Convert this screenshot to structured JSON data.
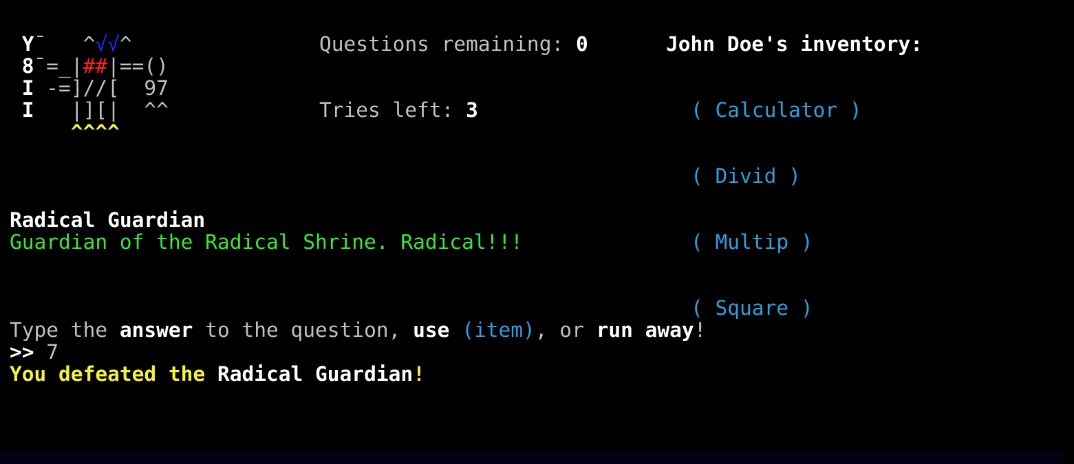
{
  "hud": {
    "questions_label": "Questions remaining: ",
    "questions_value": "0",
    "tries_label": "Tries left: ",
    "tries_value": "3"
  },
  "inventory": {
    "title": "John Doe's inventory:",
    "items": [
      "( Calculator )",
      "( Divid )",
      "( Multip )",
      "( Square )"
    ]
  },
  "art": {
    "line1": [
      {
        "t": " Y",
        "c": "white",
        "b": true
      },
      {
        "t": "¯   ",
        "c": "gray"
      },
      {
        "t": "^",
        "c": "gray"
      },
      {
        "t": "√√",
        "c": "blue"
      },
      {
        "t": "^",
        "c": "gray"
      }
    ],
    "line2": [
      {
        "t": " 8",
        "c": "white",
        "b": true
      },
      {
        "t": "¯=_|",
        "c": "gray"
      },
      {
        "t": "##",
        "c": "red"
      },
      {
        "t": "|==()",
        "c": "gray"
      }
    ],
    "line3": [
      {
        "t": " I",
        "c": "white",
        "b": true
      },
      {
        "t": " -=]//[  97",
        "c": "gray"
      }
    ],
    "line4": [
      {
        "t": " I",
        "c": "white",
        "b": true
      },
      {
        "t": "   |][|  ^^",
        "c": "gray"
      }
    ],
    "line5": [
      {
        "t": "     ^^^^",
        "c": "yellow",
        "b": true
      }
    ]
  },
  "enemy": {
    "name": "Radical Guardian",
    "description": "Guardian of the Radical Shrine. Radical!!!"
  },
  "prompt": {
    "p1": "Type the ",
    "answer": "answer",
    "p2": " to the question, ",
    "use": "use",
    "p3": " ",
    "item": "(item)",
    "p4": ", or ",
    "run": "run away",
    "p5": "!"
  },
  "input": {
    "prompt_symbol": ">>",
    "value": " 7"
  },
  "result": {
    "p1": "You defeated the ",
    "name": "Radical Guardian",
    "p2": "!"
  },
  "colors": {
    "background": "#000000",
    "text": "#c0c0c0",
    "white": "#ffffff",
    "green": "#3ae83a",
    "yellow": "#f5f03a",
    "cyan": "#2f9fe0",
    "blue": "#1a2bff",
    "red": "#ff2020"
  }
}
